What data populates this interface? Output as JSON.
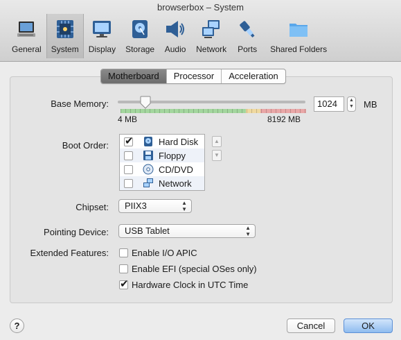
{
  "window": {
    "title": "browserbox – System"
  },
  "toolbar": {
    "items": [
      {
        "label": "General",
        "icon": "monitor-general-icon"
      },
      {
        "label": "System",
        "icon": "motherboard-chip-icon"
      },
      {
        "label": "Display",
        "icon": "display-monitor-icon"
      },
      {
        "label": "Storage",
        "icon": "storage-disk-icon"
      },
      {
        "label": "Audio",
        "icon": "speaker-icon"
      },
      {
        "label": "Network",
        "icon": "network-icon"
      },
      {
        "label": "Ports",
        "icon": "plug-icon"
      },
      {
        "label": "Shared Folders",
        "icon": "folder-icon"
      }
    ],
    "selected": "System"
  },
  "tabs": {
    "items": [
      "Motherboard",
      "Processor",
      "Acceleration"
    ],
    "selected": "Motherboard"
  },
  "base_memory": {
    "label": "Base Memory:",
    "value": "1024",
    "unit": "MB",
    "min_label": "4 MB",
    "max_label": "8192 MB",
    "slider_fraction": 0.125
  },
  "boot_order": {
    "label": "Boot Order:",
    "items": [
      {
        "label": "Hard Disk",
        "checked": true,
        "icon": "hard-disk-icon"
      },
      {
        "label": "Floppy",
        "checked": false,
        "icon": "floppy-icon"
      },
      {
        "label": "CD/DVD",
        "checked": false,
        "icon": "cd-dvd-icon"
      },
      {
        "label": "Network",
        "checked": false,
        "icon": "network-icon"
      }
    ]
  },
  "chipset": {
    "label": "Chipset:",
    "value": "PIIX3"
  },
  "pointing": {
    "label": "Pointing Device:",
    "value": "USB Tablet"
  },
  "extended": {
    "label": "Extended Features:",
    "options": [
      {
        "label": "Enable I/O APIC",
        "checked": false
      },
      {
        "label": "Enable EFI (special OSes only)",
        "checked": false
      },
      {
        "label": "Hardware Clock in UTC Time",
        "checked": true
      }
    ]
  },
  "footer": {
    "help": "?",
    "cancel": "Cancel",
    "ok": "OK"
  },
  "colors": {
    "accent": "#5b8fd6",
    "scale_green": "#9fd49a",
    "scale_red": "#e6a0a0"
  }
}
